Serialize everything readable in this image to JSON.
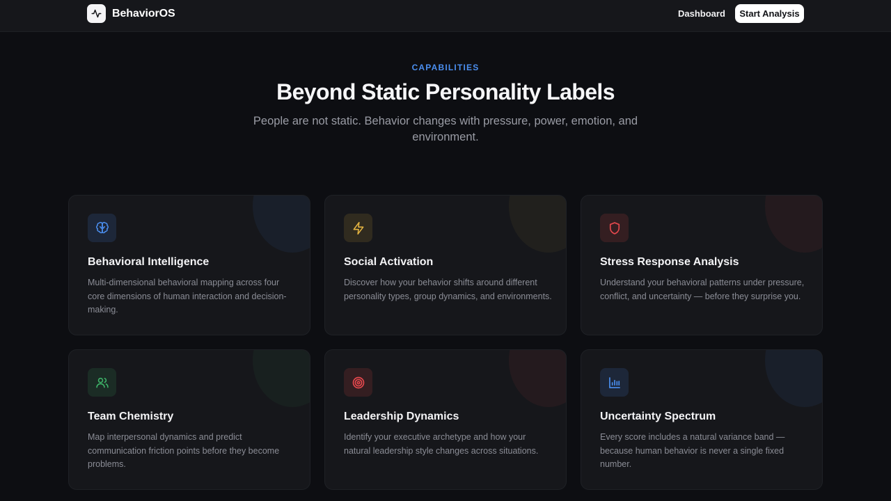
{
  "nav": {
    "brand": "BehaviorOS",
    "dashboard_label": "Dashboard",
    "cta_label": "Start Analysis"
  },
  "hero": {
    "eyebrow": "CAPABILITIES",
    "title": "Beyond Static Personality Labels",
    "subtitle": "People are not static. Behavior changes with pressure, power, emotion, and environment."
  },
  "cards": [
    {
      "title": "Behavioral Intelligence",
      "description": "Multi-dimensional behavioral mapping across four core dimensions of human interaction and decision-making.",
      "icon": "brain-icon",
      "accent": "#4b8ff0"
    },
    {
      "title": "Social Activation",
      "description": "Discover how your behavior shifts around different personality types, group dynamics, and environments.",
      "icon": "lightning-icon",
      "accent": "#e3b341"
    },
    {
      "title": "Stress Response Analysis",
      "description": "Understand your behavioral patterns under pressure, conflict, and uncertainty — before they surprise you.",
      "icon": "shield-icon",
      "accent": "#e5484d"
    },
    {
      "title": "Team Chemistry",
      "description": "Map interpersonal dynamics and predict communication friction points before they become problems.",
      "icon": "users-icon",
      "accent": "#3fb86b"
    },
    {
      "title": "Leadership Dynamics",
      "description": "Identify your executive archetype and how your natural leadership style changes across situations.",
      "icon": "target-icon",
      "accent": "#e5484d"
    },
    {
      "title": "Uncertainty Spectrum",
      "description": "Every score includes a natural variance band — because human behavior is never a single fixed number.",
      "icon": "bar-chart-icon",
      "accent": "#4b8ff0"
    }
  ]
}
